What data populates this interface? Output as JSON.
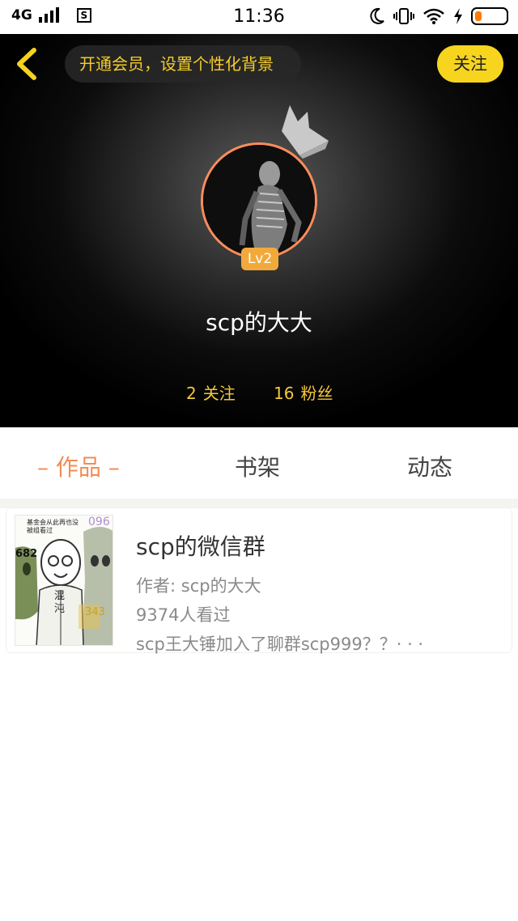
{
  "status_bar": {
    "network": "4G",
    "s_badge": "S",
    "time": "11:36"
  },
  "top_bar": {
    "vip_prompt": "开通会员，设置个性化背景",
    "follow_label": "关注"
  },
  "profile": {
    "level": "Lv2",
    "username": "scp的大大",
    "following_count": "2",
    "following_label": "关注",
    "fans_count": "16",
    "fans_label": "粉丝"
  },
  "tabs": [
    {
      "label": "作品",
      "active": true
    },
    {
      "label": "书架",
      "active": false
    },
    {
      "label": "动态",
      "active": false
    }
  ],
  "works": [
    {
      "title": "scp的微信群",
      "author": "作者: scp的大大",
      "views": "9374人看过",
      "description": "scp王大锤加入了聊群scp999？？· · ·",
      "cover_texts": {
        "caption": "基金会从此再也没被组看过",
        "num_left": "682",
        "num_top": "096",
        "num_bottom": "343",
        "center_text": "混沌"
      }
    }
  ],
  "colors": {
    "accent_orange": "#f28c54",
    "follow_yellow": "#f7d51f",
    "gold_text": "#f5c83a",
    "avatar_ring": "#ff8d5a",
    "level_badge": "#f2a93b"
  }
}
